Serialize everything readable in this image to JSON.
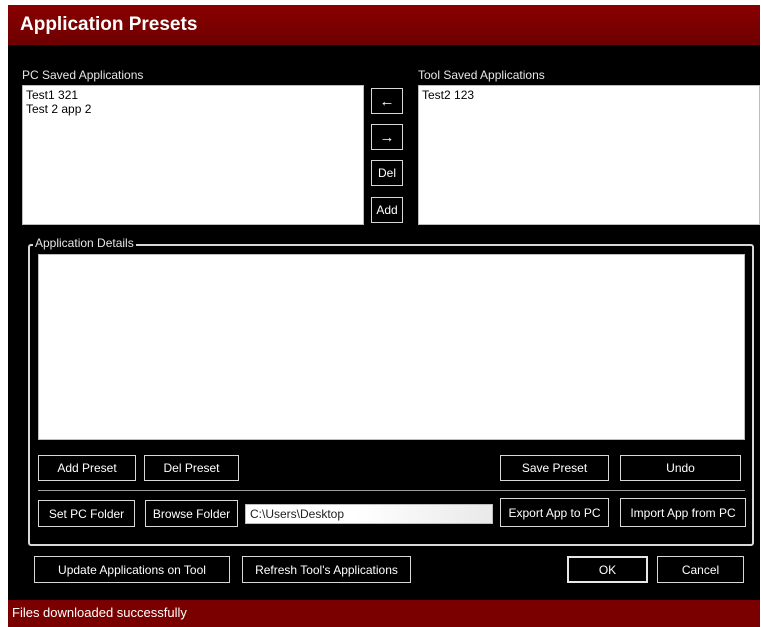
{
  "window": {
    "title": "Application Presets"
  },
  "pc_list": {
    "label": "PC Saved Applications",
    "items": [
      "Test1 321",
      "Test 2 app 2"
    ]
  },
  "tool_list": {
    "label": "Tool Saved Applications",
    "items": [
      "Test2 123"
    ]
  },
  "transfer_buttons": {
    "to_pc": "←",
    "to_tool": "→",
    "delete": "Del",
    "add": "Add"
  },
  "details": {
    "label": "Application Details",
    "content": ""
  },
  "preset_buttons": {
    "add_preset": "Add Preset",
    "del_preset": "Del Preset",
    "save_preset": "Save Preset",
    "undo": "Undo"
  },
  "folder_row": {
    "set_pc_folder": "Set PC Folder",
    "browse_folder": "Browse Folder",
    "path": "C:\\Users\\Desktop",
    "export_app": "Export App to PC",
    "import_app": "Import App from PC"
  },
  "bottom_buttons": {
    "update": "Update Applications on Tool",
    "refresh": "Refresh Tool's Applications",
    "ok": "OK",
    "cancel": "Cancel"
  },
  "status": {
    "text": "Files downloaded successfully"
  },
  "colors": {
    "title_bar": "#7a0000",
    "background": "#000000",
    "status_bar": "#7a0000",
    "border": "#d8d8d8"
  }
}
